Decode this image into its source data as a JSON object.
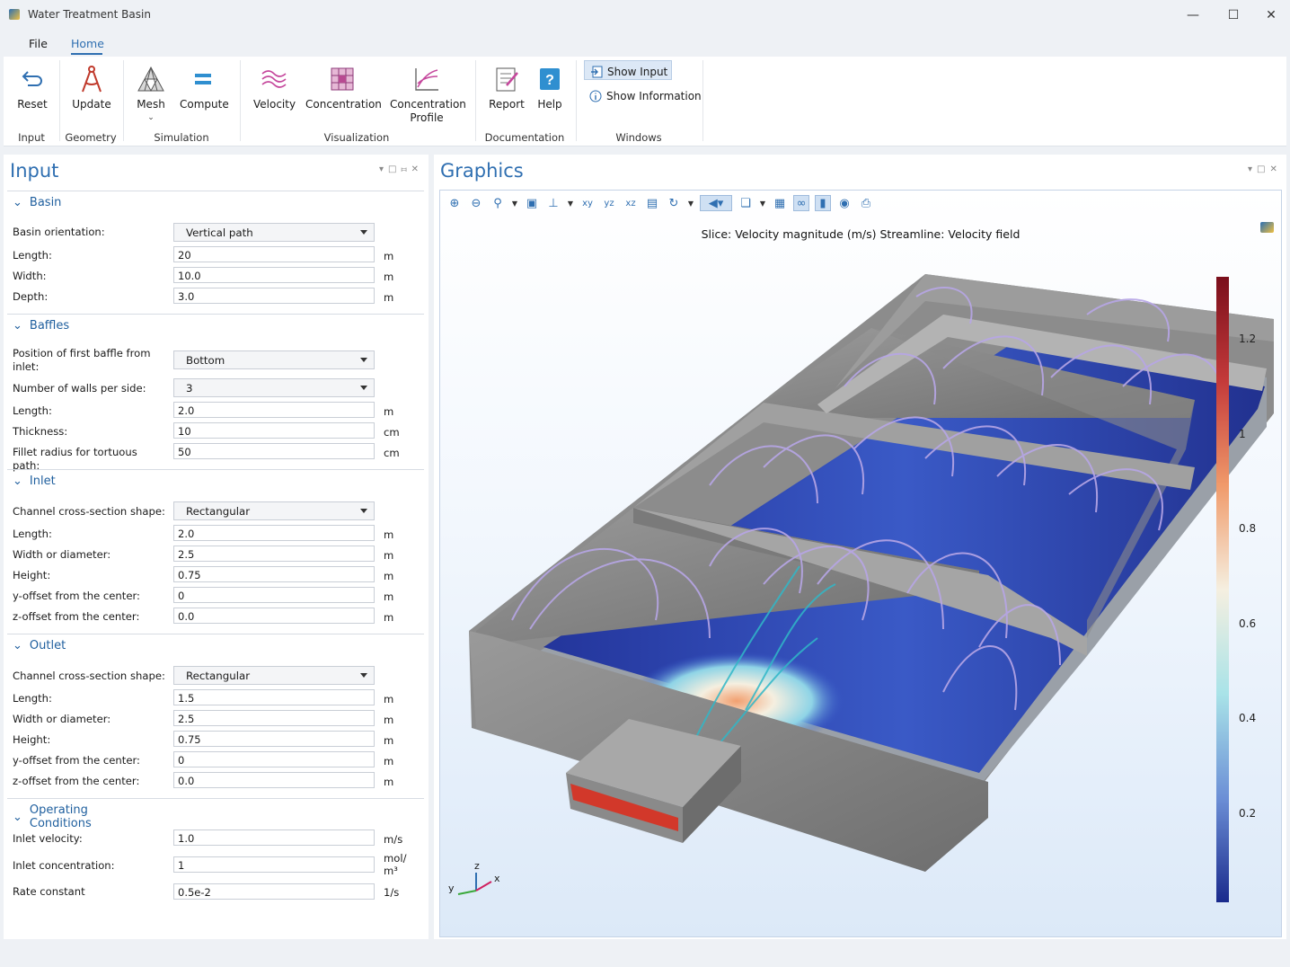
{
  "window": {
    "title": "Water Treatment Basin",
    "minimize_icon": "minimize-icon",
    "maximize_icon": "maximize-icon",
    "close_icon": "close-icon"
  },
  "menu": {
    "file": "File",
    "home": "Home"
  },
  "ribbon": {
    "reset": "Reset",
    "update": "Update",
    "mesh": "Mesh",
    "compute": "Compute",
    "velocity": "Velocity",
    "concentration": "Concentration",
    "concentration_profile_1": "Concentration",
    "concentration_profile_2": "Profile",
    "report": "Report",
    "help": "Help",
    "show_input": "Show Input",
    "show_information": "Show Information",
    "groups": {
      "input": "Input",
      "geometry": "Geometry",
      "simulation": "Simulation",
      "visualization": "Visualization",
      "documentation": "Documentation",
      "windows": "Windows"
    }
  },
  "input_panel": {
    "title": "Input",
    "basin": {
      "header": "Basin",
      "orientation_label": "Basin orientation:",
      "orientation_value": "Vertical path",
      "length_label": "Length:",
      "length_value": "20",
      "length_unit": "m",
      "width_label": "Width:",
      "width_value": "10.0",
      "width_unit": "m",
      "depth_label": "Depth:",
      "depth_value": "3.0",
      "depth_unit": "m"
    },
    "baffles": {
      "header": "Baffles",
      "position_label": "Position of first baffle from inlet:",
      "position_value": "Bottom",
      "walls_label": "Number of walls per side:",
      "walls_value": "3",
      "length_label": "Length:",
      "length_value": "2.0",
      "length_unit": "m",
      "thickness_label": "Thickness:",
      "thickness_value": "10",
      "thickness_unit": "cm",
      "fillet_label": "Fillet radius for tortuous path:",
      "fillet_value": "50",
      "fillet_unit": "cm"
    },
    "inlet": {
      "header": "Inlet",
      "shape_label": "Channel cross-section shape:",
      "shape_value": "Rectangular",
      "length_label": "Length:",
      "length_value": "2.0",
      "length_unit": "m",
      "width_label": "Width or diameter:",
      "width_value": "2.5",
      "width_unit": "m",
      "height_label": "Height:",
      "height_value": "0.75",
      "height_unit": "m",
      "yoff_label": "y-offset from the center:",
      "yoff_value": "0",
      "yoff_unit": "m",
      "zoff_label": "z-offset from the center:",
      "zoff_value": "0.0",
      "zoff_unit": "m"
    },
    "outlet": {
      "header": "Outlet",
      "shape_label": "Channel cross-section shape:",
      "shape_value": "Rectangular",
      "length_label": "Length:",
      "length_value": "1.5",
      "length_unit": "m",
      "width_label": "Width or diameter:",
      "width_value": "2.5",
      "width_unit": "m",
      "height_label": "Height:",
      "height_value": "0.75",
      "height_unit": "m",
      "yoff_label": "y-offset from the center:",
      "yoff_value": "0",
      "yoff_unit": "m",
      "zoff_label": "z-offset from the center:",
      "zoff_value": "0.0",
      "zoff_unit": "m"
    },
    "operating": {
      "header": "Operating Conditions",
      "velocity_label": "Inlet velocity:",
      "velocity_value": "1.0",
      "velocity_unit": "m/s",
      "conc_label": "Inlet concentration:",
      "conc_value": "1",
      "conc_unit_1": "mol/",
      "conc_unit_2": "m³",
      "rate_label": "Rate constant",
      "rate_value": "0.5e-2",
      "rate_unit": "1/s"
    }
  },
  "graphics": {
    "title": "Graphics",
    "plot_title": "Slice: Velocity magnitude (m/s)  Streamline: Velocity field",
    "colorbar_ticks": [
      "1.2",
      "1",
      "0.8",
      "0.6",
      "0.4",
      "0.2"
    ],
    "axes": {
      "x": "x",
      "y": "y",
      "z": "z"
    },
    "colormap_colors": [
      "#7a0f1c",
      "#c43a3a",
      "#f09a6a",
      "#f5efe0",
      "#a9e3e8",
      "#6c8fd6",
      "#1a2a8c"
    ]
  }
}
